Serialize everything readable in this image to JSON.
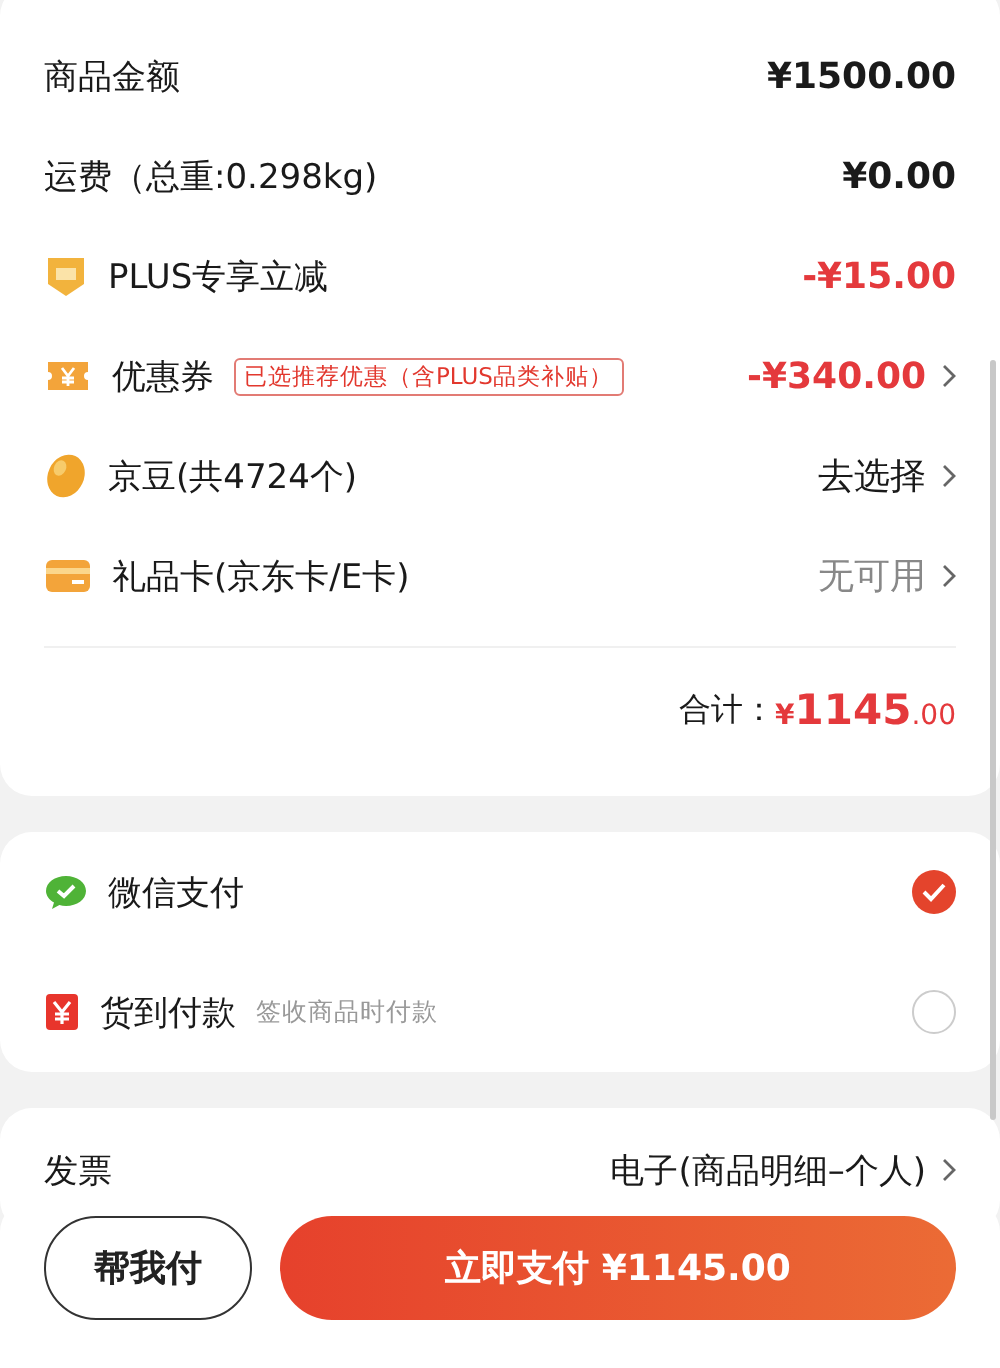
{
  "summary": {
    "rows": [
      {
        "kind": "fee",
        "label": "商品金额",
        "value": "¥1500.00",
        "arrow": false
      },
      {
        "kind": "fee",
        "label": "运费（总重:0.298kg)",
        "value": "¥0.00",
        "arrow": false
      },
      {
        "kind": "plus",
        "label": "PLUS专享立减",
        "value": "-¥15.00",
        "arrow": false
      },
      {
        "kind": "coupon",
        "label": "优惠券",
        "tag": "已选推荐优惠（含PLUS品类补贴）",
        "value": "-¥340.00",
        "arrow": true
      },
      {
        "kind": "beans",
        "label": "京豆(共4724个)",
        "value": "去选择",
        "arrow": true
      },
      {
        "kind": "giftcard",
        "label": "礼品卡(京东卡/E卡)",
        "value": "无可用",
        "arrow": true
      }
    ],
    "total": {
      "label": "合计：",
      "currency": "¥",
      "integer": "1145",
      "decimals": ".00"
    }
  },
  "payment_methods": [
    {
      "kind": "wechat",
      "label": "微信支付",
      "selected": true
    },
    {
      "kind": "cash",
      "label": "货到付款",
      "note": "签收商品时付款",
      "selected": false
    }
  ],
  "invoice": {
    "label": "发票",
    "value": "电子(商品明细–个人)"
  },
  "footer": {
    "helper_button": "帮我付",
    "pay_button": "立即支付 ¥1145.00"
  }
}
